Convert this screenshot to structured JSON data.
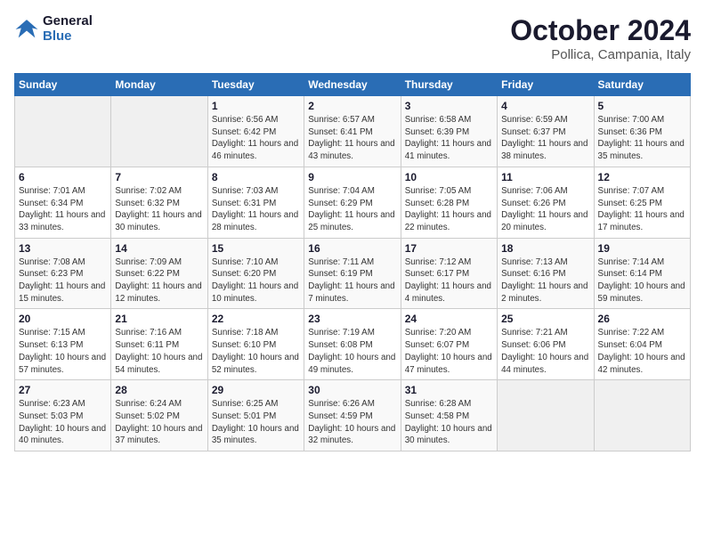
{
  "logo": {
    "line1": "General",
    "line2": "Blue"
  },
  "title": "October 2024",
  "subtitle": "Pollica, Campania, Italy",
  "headers": [
    "Sunday",
    "Monday",
    "Tuesday",
    "Wednesday",
    "Thursday",
    "Friday",
    "Saturday"
  ],
  "weeks": [
    [
      {
        "day": "",
        "details": ""
      },
      {
        "day": "",
        "details": ""
      },
      {
        "day": "1",
        "details": "Sunrise: 6:56 AM\nSunset: 6:42 PM\nDaylight: 11 hours and 46 minutes."
      },
      {
        "day": "2",
        "details": "Sunrise: 6:57 AM\nSunset: 6:41 PM\nDaylight: 11 hours and 43 minutes."
      },
      {
        "day": "3",
        "details": "Sunrise: 6:58 AM\nSunset: 6:39 PM\nDaylight: 11 hours and 41 minutes."
      },
      {
        "day": "4",
        "details": "Sunrise: 6:59 AM\nSunset: 6:37 PM\nDaylight: 11 hours and 38 minutes."
      },
      {
        "day": "5",
        "details": "Sunrise: 7:00 AM\nSunset: 6:36 PM\nDaylight: 11 hours and 35 minutes."
      }
    ],
    [
      {
        "day": "6",
        "details": "Sunrise: 7:01 AM\nSunset: 6:34 PM\nDaylight: 11 hours and 33 minutes."
      },
      {
        "day": "7",
        "details": "Sunrise: 7:02 AM\nSunset: 6:32 PM\nDaylight: 11 hours and 30 minutes."
      },
      {
        "day": "8",
        "details": "Sunrise: 7:03 AM\nSunset: 6:31 PM\nDaylight: 11 hours and 28 minutes."
      },
      {
        "day": "9",
        "details": "Sunrise: 7:04 AM\nSunset: 6:29 PM\nDaylight: 11 hours and 25 minutes."
      },
      {
        "day": "10",
        "details": "Sunrise: 7:05 AM\nSunset: 6:28 PM\nDaylight: 11 hours and 22 minutes."
      },
      {
        "day": "11",
        "details": "Sunrise: 7:06 AM\nSunset: 6:26 PM\nDaylight: 11 hours and 20 minutes."
      },
      {
        "day": "12",
        "details": "Sunrise: 7:07 AM\nSunset: 6:25 PM\nDaylight: 11 hours and 17 minutes."
      }
    ],
    [
      {
        "day": "13",
        "details": "Sunrise: 7:08 AM\nSunset: 6:23 PM\nDaylight: 11 hours and 15 minutes."
      },
      {
        "day": "14",
        "details": "Sunrise: 7:09 AM\nSunset: 6:22 PM\nDaylight: 11 hours and 12 minutes."
      },
      {
        "day": "15",
        "details": "Sunrise: 7:10 AM\nSunset: 6:20 PM\nDaylight: 11 hours and 10 minutes."
      },
      {
        "day": "16",
        "details": "Sunrise: 7:11 AM\nSunset: 6:19 PM\nDaylight: 11 hours and 7 minutes."
      },
      {
        "day": "17",
        "details": "Sunrise: 7:12 AM\nSunset: 6:17 PM\nDaylight: 11 hours and 4 minutes."
      },
      {
        "day": "18",
        "details": "Sunrise: 7:13 AM\nSunset: 6:16 PM\nDaylight: 11 hours and 2 minutes."
      },
      {
        "day": "19",
        "details": "Sunrise: 7:14 AM\nSunset: 6:14 PM\nDaylight: 10 hours and 59 minutes."
      }
    ],
    [
      {
        "day": "20",
        "details": "Sunrise: 7:15 AM\nSunset: 6:13 PM\nDaylight: 10 hours and 57 minutes."
      },
      {
        "day": "21",
        "details": "Sunrise: 7:16 AM\nSunset: 6:11 PM\nDaylight: 10 hours and 54 minutes."
      },
      {
        "day": "22",
        "details": "Sunrise: 7:18 AM\nSunset: 6:10 PM\nDaylight: 10 hours and 52 minutes."
      },
      {
        "day": "23",
        "details": "Sunrise: 7:19 AM\nSunset: 6:08 PM\nDaylight: 10 hours and 49 minutes."
      },
      {
        "day": "24",
        "details": "Sunrise: 7:20 AM\nSunset: 6:07 PM\nDaylight: 10 hours and 47 minutes."
      },
      {
        "day": "25",
        "details": "Sunrise: 7:21 AM\nSunset: 6:06 PM\nDaylight: 10 hours and 44 minutes."
      },
      {
        "day": "26",
        "details": "Sunrise: 7:22 AM\nSunset: 6:04 PM\nDaylight: 10 hours and 42 minutes."
      }
    ],
    [
      {
        "day": "27",
        "details": "Sunrise: 6:23 AM\nSunset: 5:03 PM\nDaylight: 10 hours and 40 minutes."
      },
      {
        "day": "28",
        "details": "Sunrise: 6:24 AM\nSunset: 5:02 PM\nDaylight: 10 hours and 37 minutes."
      },
      {
        "day": "29",
        "details": "Sunrise: 6:25 AM\nSunset: 5:01 PM\nDaylight: 10 hours and 35 minutes."
      },
      {
        "day": "30",
        "details": "Sunrise: 6:26 AM\nSunset: 4:59 PM\nDaylight: 10 hours and 32 minutes."
      },
      {
        "day": "31",
        "details": "Sunrise: 6:28 AM\nSunset: 4:58 PM\nDaylight: 10 hours and 30 minutes."
      },
      {
        "day": "",
        "details": ""
      },
      {
        "day": "",
        "details": ""
      }
    ]
  ]
}
